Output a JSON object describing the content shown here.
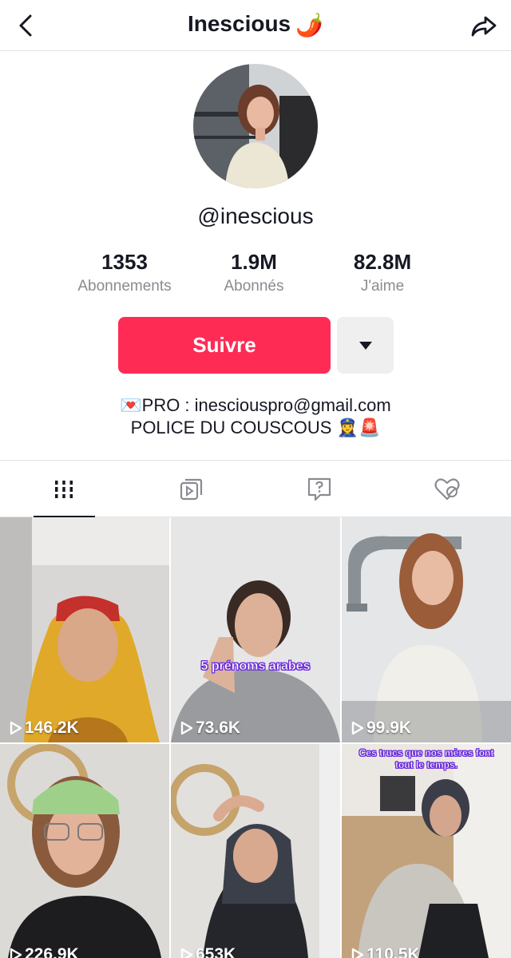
{
  "header": {
    "title": "Inescious",
    "title_emoji": "🌶️"
  },
  "profile": {
    "username": "@inescious",
    "stats": [
      {
        "value": "1353",
        "label": "Abonnements"
      },
      {
        "value": "1.9M",
        "label": "Abonnés"
      },
      {
        "value": "82.8M",
        "label": "J'aime"
      }
    ],
    "follow_label": "Suivre",
    "bio_line1": "💌PRO : inesciouspro@gmail.com",
    "bio_line2": "POLICE DU COUSCOUS 👮‍♀️🚨"
  },
  "tabs": [
    {
      "icon": "grid-icon",
      "active": true
    },
    {
      "icon": "repost-icon",
      "active": false
    },
    {
      "icon": "question-icon",
      "active": false
    },
    {
      "icon": "liked-hidden-icon",
      "active": false
    }
  ],
  "videos": [
    {
      "views": "146.2K",
      "overlay": ""
    },
    {
      "views": "73.6K",
      "overlay": "5 prénoms arabes"
    },
    {
      "views": "99.9K",
      "overlay": ""
    },
    {
      "views": "226.9K",
      "overlay": ""
    },
    {
      "views": "653K",
      "overlay": ""
    },
    {
      "views": "110.5K",
      "overlay": "Ces trucs que nos mères font tout le temps."
    }
  ],
  "colors": {
    "accent": "#fe2c55",
    "text": "#161823",
    "secondary_text": "#8a8b91"
  }
}
